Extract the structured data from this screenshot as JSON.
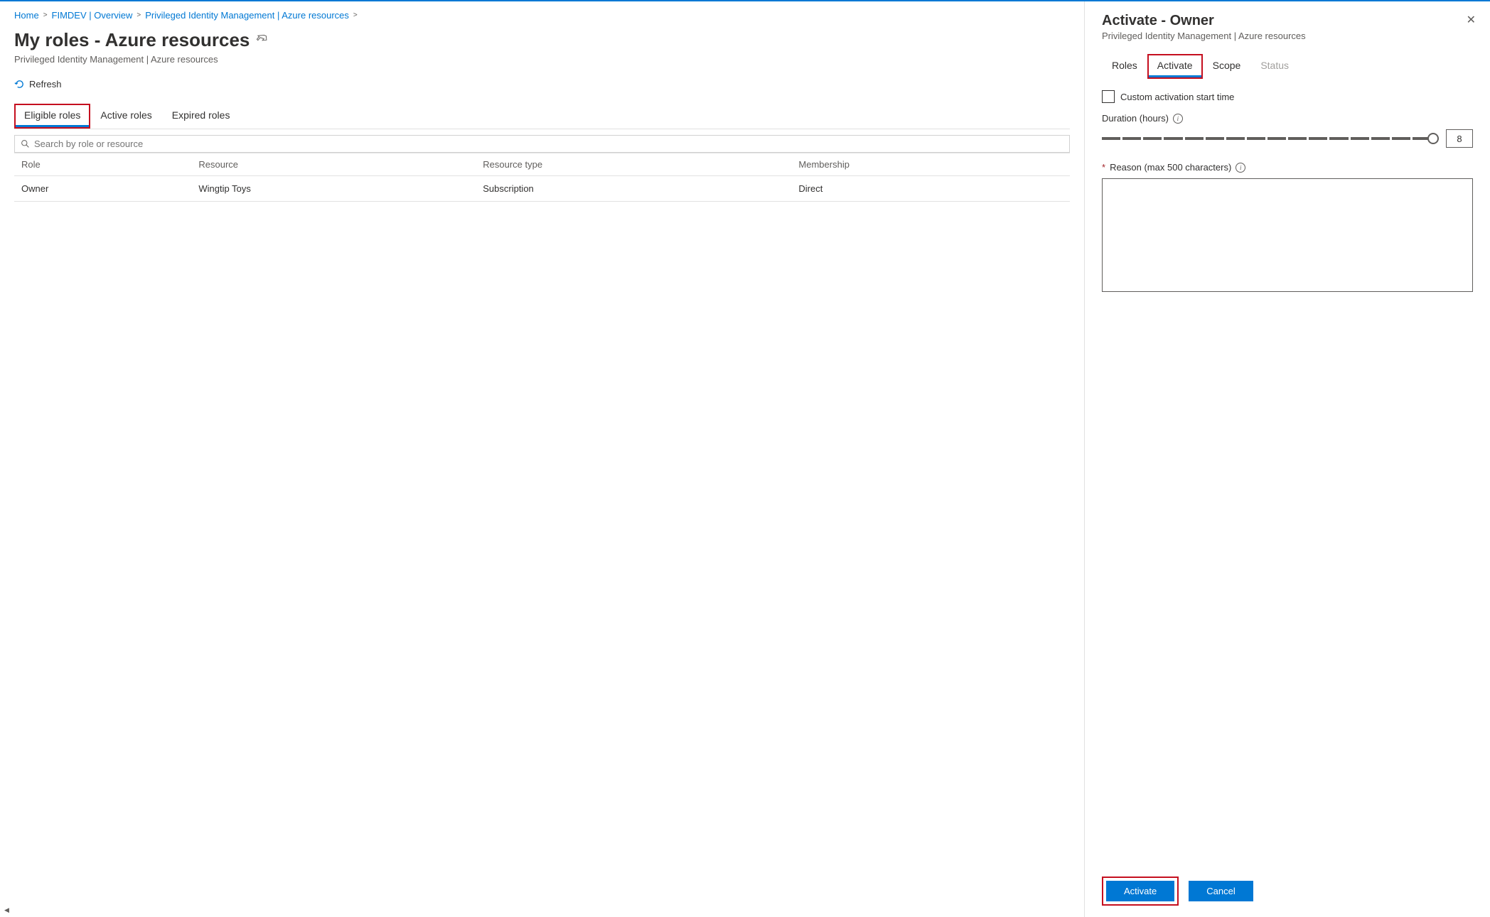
{
  "breadcrumb": {
    "items": [
      {
        "label": "Home"
      },
      {
        "label": "FIMDEV | Overview"
      },
      {
        "label": "Privileged Identity Management | Azure resources"
      }
    ]
  },
  "page": {
    "title": "My roles - Azure resources",
    "subtitle": "Privileged Identity Management | Azure resources"
  },
  "toolbar": {
    "refresh": "Refresh"
  },
  "mainTabs": [
    {
      "label": "Eligible roles",
      "active": true
    },
    {
      "label": "Active roles",
      "active": false
    },
    {
      "label": "Expired roles",
      "active": false
    }
  ],
  "search": {
    "placeholder": "Search by role or resource"
  },
  "table": {
    "headers": [
      "Role",
      "Resource",
      "Resource type",
      "Membership"
    ],
    "rows": [
      [
        "Owner",
        "Wingtip Toys",
        "Subscription",
        "Direct"
      ]
    ]
  },
  "panel": {
    "title": "Activate - Owner",
    "subtitle": "Privileged Identity Management | Azure resources",
    "tabs": [
      {
        "label": "Roles",
        "state": "normal"
      },
      {
        "label": "Activate",
        "state": "active"
      },
      {
        "label": "Scope",
        "state": "normal"
      },
      {
        "label": "Status",
        "state": "disabled"
      }
    ],
    "customStart": "Custom activation start time",
    "durationLabel": "Duration (hours)",
    "durationValue": "8",
    "reasonLabel": "Reason (max 500 characters)",
    "footer": {
      "activate": "Activate",
      "cancel": "Cancel"
    }
  }
}
